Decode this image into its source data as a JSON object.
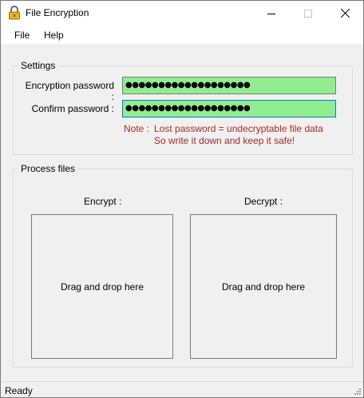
{
  "window": {
    "title": "File Encryption",
    "icon": "lock-icon"
  },
  "menu": {
    "file": "File",
    "help": "Help"
  },
  "settings": {
    "legend": "Settings",
    "encryption_label": "Encryption password :",
    "encryption_value": "●●●●●●●●●●●●●●●●●●●",
    "confirm_label": "Confirm password :",
    "confirm_value": "●●●●●●●●●●●●●●●●●●●",
    "field_color": "#90ee90",
    "note_prefix": "Note :",
    "note_line1": "Lost password = undecryptable file data",
    "note_line2": "So write it down and keep it safe!",
    "note_color": "#a52a2a"
  },
  "process": {
    "legend": "Process files",
    "encrypt_label": "Encrypt :",
    "decrypt_label": "Decrypt :",
    "encrypt_drop": "Drag and drop here",
    "decrypt_drop": "Drag and drop here"
  },
  "status": {
    "text": "Ready"
  }
}
